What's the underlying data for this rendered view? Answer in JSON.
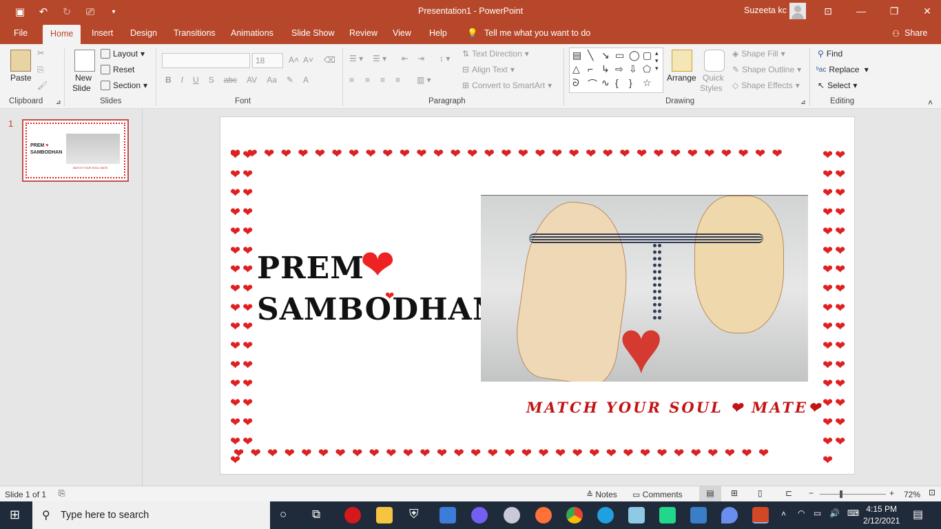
{
  "titlebar": {
    "document_title": "Presentation1  -  PowerPoint",
    "user_name": "Suzeeta kc"
  },
  "tabs": [
    "File",
    "Home",
    "Insert",
    "Design",
    "Transitions",
    "Animations",
    "Slide Show",
    "Review",
    "View",
    "Help"
  ],
  "tell_me": "Tell me what you want to do",
  "share": "Share",
  "ribbon": {
    "clipboard": {
      "paste": "Paste",
      "label": "Clipboard"
    },
    "slides": {
      "new_slide": "New",
      "new_slide2": "Slide",
      "layout": "Layout",
      "reset": "Reset",
      "section": "Section",
      "label": "Slides"
    },
    "font": {
      "size": "18",
      "label": "Font"
    },
    "paragraph": {
      "text_direction": "Text Direction",
      "align_text": "Align Text",
      "smartart": "Convert to SmartArt",
      "label": "Paragraph"
    },
    "drawing": {
      "arrange": "Arrange",
      "quick": "Quick",
      "styles": "Styles",
      "shape_fill": "Shape Fill",
      "shape_outline": "Shape Outline",
      "shape_effects": "Shape Effects",
      "label": "Drawing"
    },
    "editing": {
      "find": "Find",
      "replace": "Replace",
      "select": "Select",
      "label": "Editing"
    }
  },
  "thumbnail": {
    "number": "1",
    "line1": "PREM",
    "line2": "SAMBODHAN",
    "tagline": "MATCH YOUR SOUL MATE"
  },
  "slide": {
    "title_line1": "PREM",
    "title_line2": "SAMBODHAN",
    "tagline": "MATCH YOUR SOUL",
    "tagline2": "MATE"
  },
  "status": {
    "slide_info": "Slide 1 of 1",
    "notes": "Notes",
    "comments": "Comments",
    "zoom": "72%"
  },
  "taskbar": {
    "search_placeholder": "Type here to search",
    "time": "4:15 PM",
    "date": "2/12/2021"
  },
  "colors": {
    "accent": "#b7472a",
    "heart": "#e02020",
    "tagline": "#c21414"
  }
}
